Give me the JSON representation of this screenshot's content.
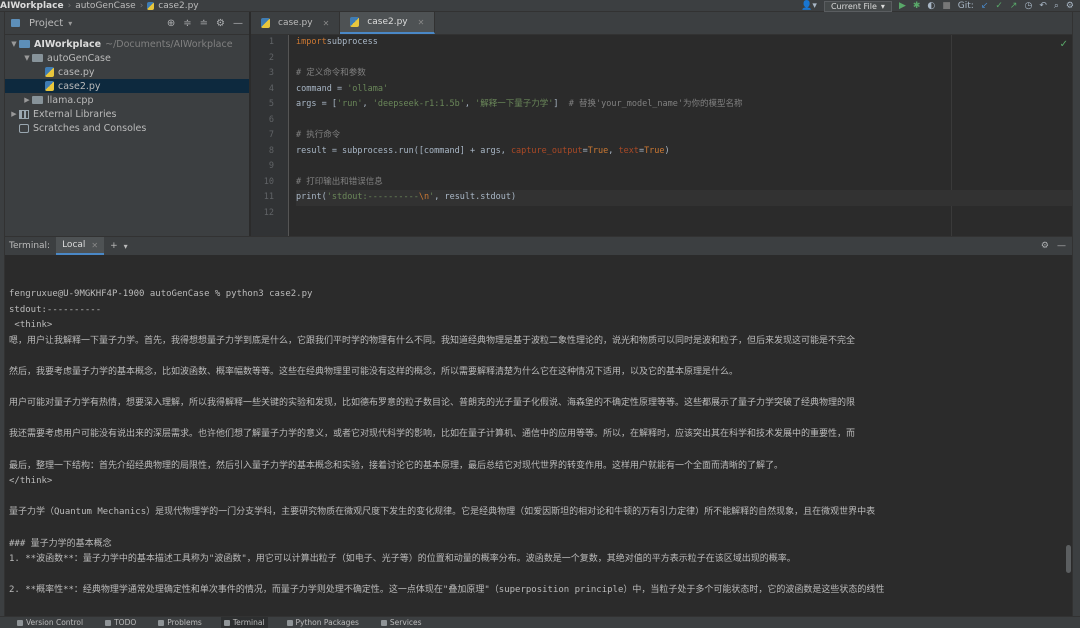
{
  "breadcrumb": {
    "project": "AIWorkplace",
    "folder": "autoGenCase",
    "file": "case2.py"
  },
  "toolbar": {
    "run_config": "Current File",
    "git_label": "Git:"
  },
  "project_panel": {
    "title": "Project",
    "tree": [
      {
        "level": 0,
        "expanded": true,
        "icon": "folder",
        "label": "AIWorkplace",
        "bold": true,
        "path": "~/Documents/AIWorkplace"
      },
      {
        "level": 1,
        "expanded": true,
        "icon": "folder",
        "label": "autoGenCase"
      },
      {
        "level": 2,
        "icon": "python-file",
        "label": "case.py"
      },
      {
        "level": 2,
        "icon": "python-file",
        "label": "case2.py",
        "selected": true
      },
      {
        "level": 1,
        "expanded": false,
        "icon": "folder",
        "label": "llama.cpp"
      },
      {
        "level": 0,
        "expanded": false,
        "icon": "library",
        "label": "External Libraries"
      },
      {
        "level": 0,
        "icon": "scratch",
        "label": "Scratches and Consoles"
      }
    ]
  },
  "editor": {
    "tabs": [
      {
        "label": "case.py",
        "active": false
      },
      {
        "label": "case2.py",
        "active": true
      }
    ],
    "current_line": 11,
    "lines": [
      [
        [
          "kw",
          "import"
        ],
        [
          "",
          "subprocess"
        ]
      ],
      [],
      [
        [
          "cmt",
          "# 定义命令和参数"
        ]
      ],
      [
        [
          "",
          "command = "
        ],
        [
          "str",
          "'ollama'"
        ]
      ],
      [
        [
          "",
          "args = ["
        ],
        [
          "str",
          "'run'"
        ],
        [
          "",
          ", "
        ],
        [
          "str",
          "'deepseek-r1:1.5b'"
        ],
        [
          "",
          ", "
        ],
        [
          "str",
          "'解释一下量子力学'"
        ],
        [
          "",
          "]  "
        ],
        [
          "cmt",
          "# 替换'your_model_name'为你的模型名称"
        ]
      ],
      [],
      [
        [
          "cmt",
          "# 执行命令"
        ]
      ],
      [
        [
          "",
          "result = subprocess.run([command] + args, "
        ],
        [
          "prm",
          "capture_output"
        ],
        [
          "",
          "="
        ],
        [
          "kw",
          "True"
        ],
        [
          "",
          ", "
        ],
        [
          "prm",
          "text"
        ],
        [
          "",
          "="
        ],
        [
          "kw",
          "True"
        ],
        [
          "",
          ")"
        ]
      ],
      [],
      [
        [
          "cmt",
          "# 打印输出和错误信息"
        ]
      ],
      [
        [
          "",
          "print("
        ],
        [
          "str",
          "'stdout:----------"
        ],
        [
          "kw",
          "\\n"
        ],
        [
          "str",
          "'"
        ],
        [
          "",
          ", result.stdout)"
        ]
      ],
      []
    ]
  },
  "terminal": {
    "label": "Terminal:",
    "tab": "Local",
    "lines": [
      "fengruxue@U-9MGKHF4P-1900 autoGenCase % python3 case2.py",
      "stdout:----------",
      " <think>",
      "嗯，用户让我解释一下量子力学。首先，我得想想量子力学到底是什么，它跟我们平时学的物理有什么不同。我知道经典物理是基于波粒二象性理论的，说光和物质可以同时是波和粒子，但后来发现这可能是不完全",
      "",
      "然后，我要考虑量子力学的基本概念，比如波函数、概率幅数等等。这些在经典物理里可能没有这样的概念，所以需要解释清楚为什么它在这种情况下适用，以及它的基本原理是什么。",
      "",
      "用户可能对量子力学有热情，想要深入理解，所以我得解释一些关键的实验和发现，比如德布罗意的粒子数目论、普朗克的光子量子化假说、海森堡的不确定性原理等等。这些都展示了量子力学突破了经典物理的限",
      "",
      "我还需要考虑用户可能没有说出来的深层需求。也许他们想了解量子力学的意义，或者它对现代科学的影响，比如在量子计算机、通信中的应用等等。所以，在解释时，应该突出其在科学和技术发展中的重要性，而",
      "",
      "最后，整理一下结构：首先介绍经典物理的局限性，然后引入量子力学的基本概念和实验，接着讨论它的基本原理，最后总结它对现代世界的转变作用。这样用户就能有一个全面而清晰的了解了。",
      "</think>",
      "",
      "量子力学（Quantum Mechanics）是现代物理学的一门分支学科，主要研究物质在微观尺度下发生的变化规律。它是经典物理（如爱因斯坦的相对论和牛顿的万有引力定律）所不能解释的自然现象，且在微观世界中表",
      "",
      "### 量子力学的基本概念",
      "1. **波函数**：量子力学中的基本描述工具称为\"波函数\"，用它可以计算出粒子（如电子、光子等）的位置和动量的概率分布。波函数是一个复数，其绝对值的平方表示粒子在该区域出现的概率。",
      "",
      "2. **概率性**：经典物理学通常处理确定性和单次事件的情况，而量子力学则处理不确定性。这一点体现在\"叠加原理\"（superposition principle）中，当粒子处于多个可能状态时，它的波函数是这些状态的线性"
    ]
  },
  "bottom_bar": [
    "Version Control",
    "TODO",
    "Problems",
    "Terminal",
    "Python Packages",
    "Services"
  ],
  "bottom_bar_active": "Terminal",
  "colors": {
    "accent": "#4a88c7",
    "selection": "#0d293e",
    "keyword": "#cc7832",
    "string": "#6a8759",
    "comment": "#808080"
  }
}
